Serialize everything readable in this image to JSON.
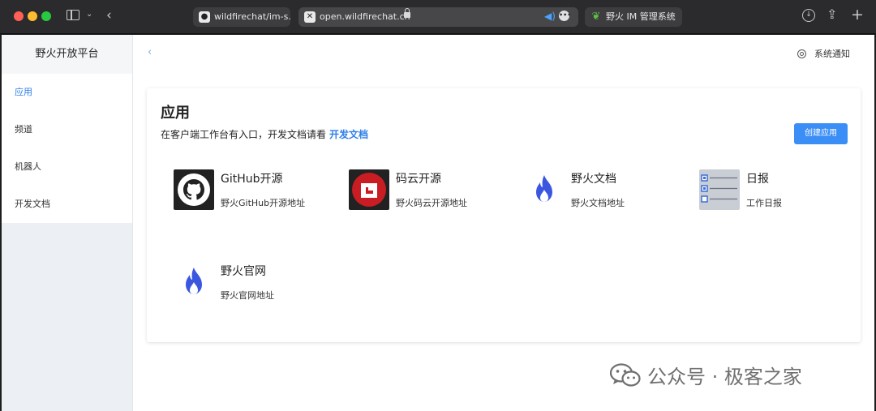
{
  "browser": {
    "tabs": [
      {
        "label": "wildfirechat/im-s..."
      },
      {
        "label": "open.wildfirechat.cn"
      },
      {
        "label": "野火 IM 管理系统"
      }
    ]
  },
  "sidebar": {
    "title": "野火开放平台",
    "items": [
      {
        "label": "应用",
        "active": true
      },
      {
        "label": "频道"
      },
      {
        "label": "机器人"
      },
      {
        "label": "开发文档"
      }
    ]
  },
  "header": {
    "notice_label": "系统通知"
  },
  "main": {
    "title": "应用",
    "subtitle": "在客户端工作台有入口，开发文档请看",
    "doc_link": "开发文档",
    "create_button": "创建应用",
    "apps": [
      {
        "name": "GitHub开源",
        "desc": "野火GitHub开源地址",
        "icon": "github-icon"
      },
      {
        "name": "码云开源",
        "desc": "野火码云开源地址",
        "icon": "gitee-icon"
      },
      {
        "name": "野火文档",
        "desc": "野火文档地址",
        "icon": "flame-icon"
      },
      {
        "name": "日报",
        "desc": "工作日报",
        "icon": "checklist-icon"
      },
      {
        "name": "野火官网",
        "desc": "野火官网地址",
        "icon": "flame-icon"
      }
    ]
  },
  "watermark": {
    "text": "公众号 · 极客之家"
  },
  "colors": {
    "accent": "#3a8ef6",
    "active_menu": "#2f7fe8",
    "gitee_red": "#c71d23",
    "flame_blue": "#3b57e0"
  }
}
